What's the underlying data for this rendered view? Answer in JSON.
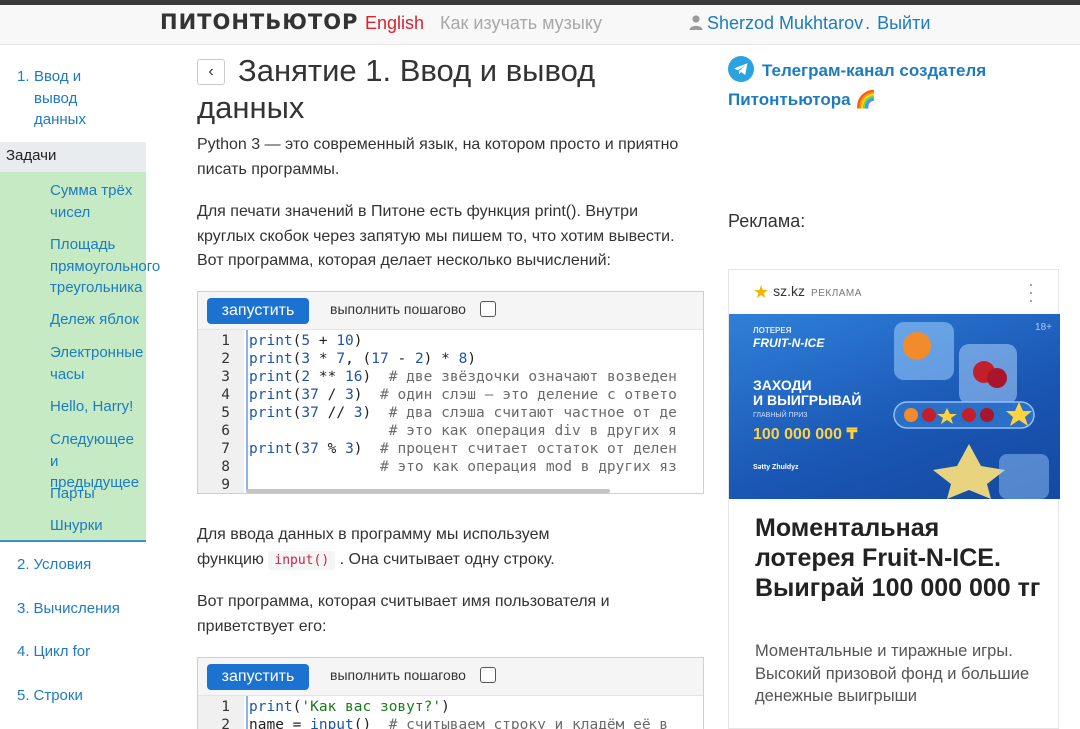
{
  "header": {
    "logo": "ПИТОНТЬЮТОР",
    "language": "English",
    "how_to": "Как изучать музыку",
    "user_name": "Sherzod Mukhtarov",
    "logout": "Выйти"
  },
  "sidebar": {
    "lesson1_num": "1.",
    "lesson1_label": [
      "Ввод и",
      "вывод",
      "данных"
    ],
    "tasks_header": "Задачи",
    "tasks": [
      [
        "Сумма трёх",
        "чисел"
      ],
      [
        "Площадь",
        "прямоугольного",
        "треугольника"
      ],
      [
        "Дележ яблок"
      ],
      [
        "Электронные",
        "часы"
      ],
      [
        "Hello, Harry!"
      ],
      [
        "Следующее и",
        "предыдущее"
      ],
      [
        "Парты"
      ],
      [
        "Шнурки"
      ]
    ],
    "lessons": [
      {
        "num": "2.",
        "label": "Условия"
      },
      {
        "num": "3.",
        "label": "Вычисления"
      },
      {
        "num": "4.",
        "label": "Цикл for"
      },
      {
        "num": "5.",
        "label": "Строки"
      }
    ]
  },
  "main": {
    "back_label": "‹",
    "title_line1": "Занятие 1. Ввод и вывод",
    "title_line2": "данных",
    "para1": [
      "Python 3 — это современный язык, на котором просто и приятно",
      "писать программы."
    ],
    "para2": [
      "Для печати значений в Питоне есть функция print(). Внутри",
      "круглых скобок через запятую мы пишем то, что хотим вывести.",
      "Вот программа, которая делает несколько вычислений:"
    ],
    "para3_before": "Для ввода данных в программу мы используем",
    "para3_prefix": "функцию",
    "para3_code": "input()",
    "para3_suffix": ". Она считывает одну строку.",
    "para4": [
      "Вот программа, которая считывает имя пользователя и",
      "приветствует его:"
    ],
    "run_label": "запустить",
    "step_label": "выполнить пошагово",
    "code1": [
      {
        "n": "1",
        "text": "print(5 + 10)"
      },
      {
        "n": "2",
        "text": "print(3 * 7, (17 - 2) * 8)"
      },
      {
        "n": "3",
        "text": "print(2 ** 16)  # две звёздочки означают возведен"
      },
      {
        "n": "4",
        "text": "print(37 / 3)  # один слэш — это деление с ответо"
      },
      {
        "n": "5",
        "text": "print(37 // 3)  # два слэша считают частное от де"
      },
      {
        "n": "6",
        "text": "                # это как операция div в других я"
      },
      {
        "n": "7",
        "text": "print(37 % 3)  # процент считает остаток от делен"
      },
      {
        "n": "8",
        "text": "               # это как операция mod в других яз"
      },
      {
        "n": "9",
        "text": ""
      }
    ],
    "code2": [
      {
        "n": "1",
        "text": "print('Как вас зовут?')"
      },
      {
        "n": "2",
        "text": "name = input()  # считываем строку и кладём её в"
      }
    ]
  },
  "right": {
    "telegram_line1": "Телеграм-канал создателя",
    "telegram_line2": "Питонтьютора 🌈",
    "ads_label": "Реклама:",
    "ad": {
      "source": "sz.kz",
      "tag": "РЕКЛАМА",
      "banner_small": "ЛОТЕРЕЯ",
      "banner_brand": "FRUIT-N-ICE",
      "banner_cta_line1": "ЗАХОДИ",
      "banner_cta_line2": "И ВЫИГРЫВАЙ",
      "banner_prize_label": "ГЛАВНЫЙ ПРИЗ",
      "banner_prize": "100 000 000 ₸",
      "banner_logo": "Sətty Zhuldyz",
      "banner_age": "18+",
      "title": "Моментальная лотерея Fruit-N-ICE. Выиграй 100 000 000 тг",
      "desc": "Моментальные и тиражные игры. Высокий призовой фонд и большие денежные выигрыши"
    }
  },
  "colors": {
    "link": "#1d7bbf",
    "run_button": "#1b72d0",
    "tasks_bg": "#c6ebc4",
    "english": "#d9232e"
  }
}
